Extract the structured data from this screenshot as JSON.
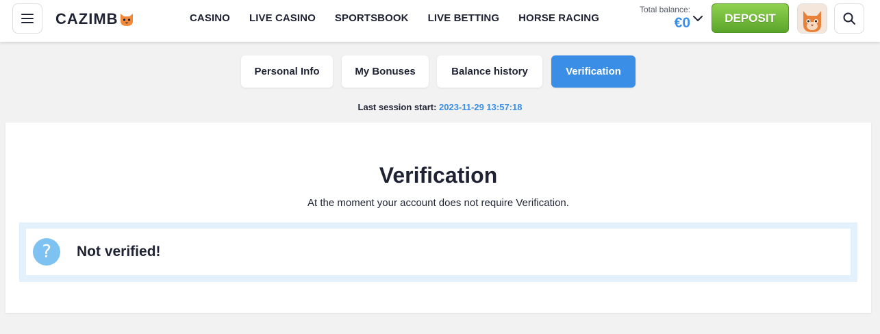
{
  "header": {
    "logo_text": "CAZIMB",
    "nav": [
      "CASINO",
      "LIVE CASINO",
      "SPORTSBOOK",
      "LIVE BETTING",
      "HORSE RACING"
    ],
    "balance_label": "Total balance:",
    "balance_amount": "€0",
    "deposit_label": "DEPOSIT"
  },
  "tabs": [
    {
      "label": "Personal Info",
      "active": false
    },
    {
      "label": "My Bonuses",
      "active": false
    },
    {
      "label": "Balance history",
      "active": false
    },
    {
      "label": "Verification",
      "active": true
    }
  ],
  "session": {
    "label": "Last session start:",
    "value": "2023-11-29 13:57:18"
  },
  "verification": {
    "title": "Verification",
    "description": "At the moment your account does not require Verification.",
    "status_text": "Not verified!",
    "status_icon": "question-icon"
  },
  "colors": {
    "accent": "#3a8ee6",
    "deposit": "#6cbb35",
    "status_bg": "#e3f1fc",
    "question_icon": "#7ec2f2"
  }
}
